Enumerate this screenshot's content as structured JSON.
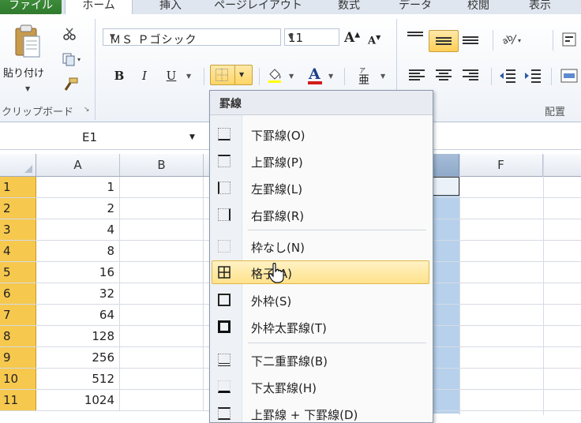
{
  "tabs": [
    "ファイル",
    "ホーム",
    "挿入",
    "ページレイアウト",
    "数式",
    "データ",
    "校閲",
    "表示"
  ],
  "clipboard": {
    "paste_label": "貼り付け",
    "group_label": "クリップボード"
  },
  "font": {
    "name": "ＭＳ Ｐゴシック",
    "size": "11"
  },
  "format_buttons": {
    "bold": "B",
    "italic": "I",
    "underline": "U"
  },
  "alignment": {
    "group_label": "配置"
  },
  "namebox": {
    "value": "E1"
  },
  "columns": [
    "A",
    "B",
    "F"
  ],
  "rows": [
    {
      "num": "1",
      "a": "1"
    },
    {
      "num": "2",
      "a": "2"
    },
    {
      "num": "3",
      "a": "4"
    },
    {
      "num": "4",
      "a": "8"
    },
    {
      "num": "5",
      "a": "16"
    },
    {
      "num": "6",
      "a": "32"
    },
    {
      "num": "7",
      "a": "64"
    },
    {
      "num": "8",
      "a": "128"
    },
    {
      "num": "9",
      "a": "256"
    },
    {
      "num": "10",
      "a": "512"
    },
    {
      "num": "11",
      "a": "1024"
    }
  ],
  "border_menu": {
    "header": "罫線",
    "items": [
      "下罫線(O)",
      "上罫線(P)",
      "左罫線(L)",
      "右罫線(R)",
      "枠なし(N)",
      "格子(A)",
      "外枠(S)",
      "外枠太罫線(T)",
      "下二重罫線(B)",
      "下太罫線(H)",
      "上罫線 + 下罫線(D)"
    ],
    "highlighted_item": "格子(A)"
  },
  "colors": {
    "accent": "#ffd564",
    "selected_col": "#b7d1ec",
    "row_header": "#f6c84e",
    "file_tab": "#2f7a2d"
  }
}
